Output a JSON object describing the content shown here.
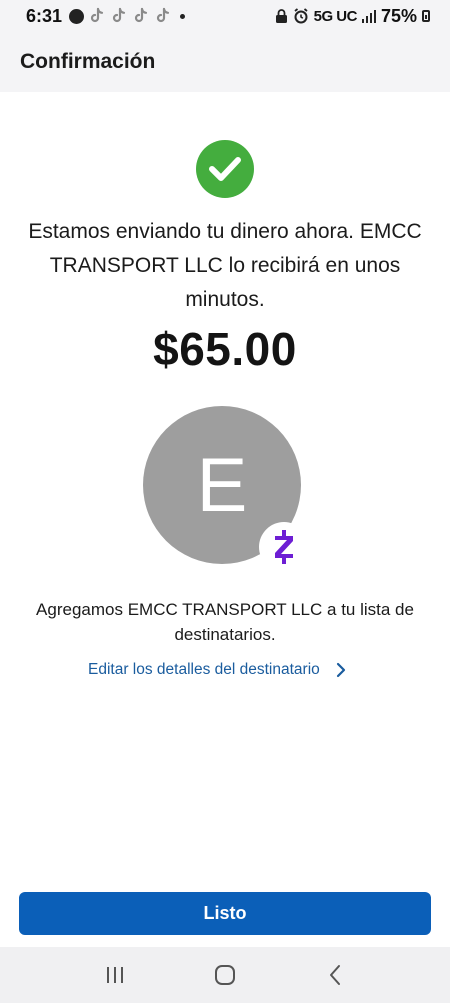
{
  "status_bar": {
    "time": "6:31",
    "network": "5G UC",
    "battery": "75%"
  },
  "header": {
    "title": "Confirmación"
  },
  "confirmation": {
    "message": "Estamos enviando tu dinero ahora. EMCC TRANSPORT LLC lo recibirá en unos minutos.",
    "amount": "$65.00",
    "avatar_initial": "E",
    "added_text": "Agregamos EMCC TRANSPORT LLC a tu lista de destinatarios.",
    "edit_link_label": "Editar los detalles del destinatario"
  },
  "done_button": {
    "label": "Listo"
  },
  "icons": {
    "success": "check-circle-icon",
    "payment_network": "zelle-icon",
    "edit_link": "chevron-right-icon",
    "nav_recents": "recents-icon",
    "nav_home": "home-icon",
    "nav_back": "back-icon"
  },
  "colors": {
    "success_green": "#44ad3e",
    "primary_blue": "#0b5fb8",
    "link_blue": "#1a5c9e",
    "avatar_gray": "#9e9e9e",
    "zelle_purple": "#6d1ed4"
  }
}
